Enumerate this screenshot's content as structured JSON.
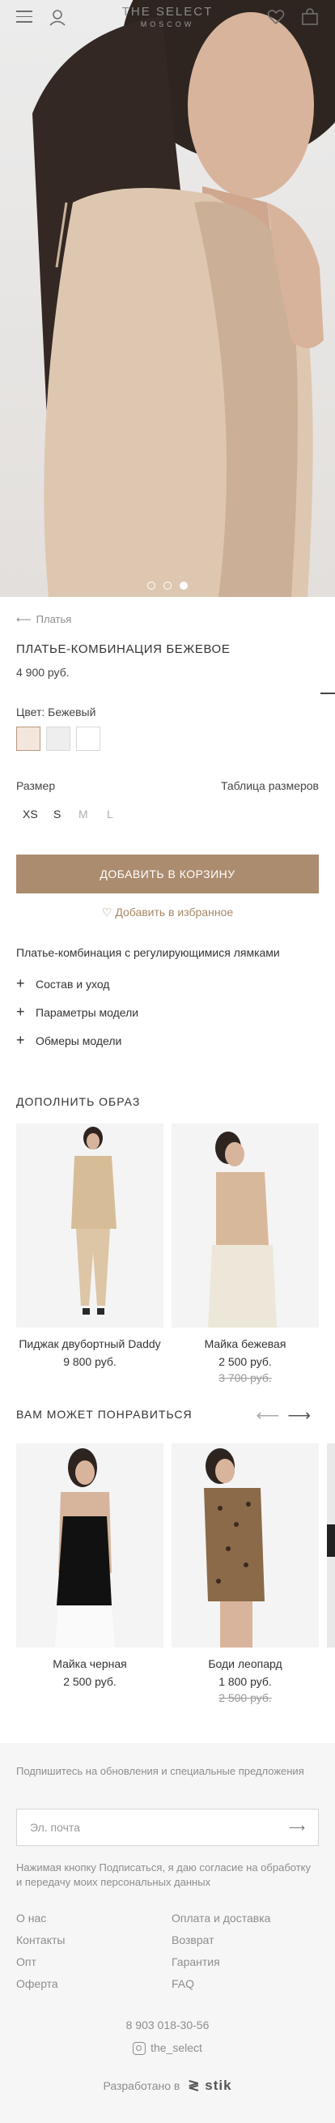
{
  "header": {
    "brand_line1": "THE SELECT",
    "brand_line2": "MOSCOW",
    "icons": [
      "menu-icon",
      "user-icon",
      "heart-icon",
      "bag-icon"
    ]
  },
  "hero": {
    "slide_count": 3,
    "active_slide": 1
  },
  "breadcrumb": {
    "back_label": "Платья"
  },
  "product": {
    "title": "ПЛАТЬЕ-КОМБИНАЦИЯ БЕЖЕВОЕ",
    "price": "4 900 руб.",
    "color_label": "Цвет: Бежевый",
    "swatches": [
      "#f3e6dc",
      "#eeeeee",
      "#ffffff"
    ],
    "size_label": "Размер",
    "size_table_label": "Таблица размеров",
    "sizes": [
      "XS",
      "S",
      "M",
      "L"
    ],
    "add_to_cart_label": "ДОБАВИТЬ В КОРЗИНУ",
    "favorite_label": "Добавить в избранное",
    "description": "Платье-комбинация с регулирующимися лямками",
    "accordion": [
      "Состав и уход",
      "Параметры модели",
      "Обмеры модели"
    ]
  },
  "complete_look": {
    "heading": "ДОПОЛНИТЬ ОБРАЗ",
    "items": [
      {
        "name": "Пиджак двубортный Daddy",
        "price": "9 800 руб.",
        "old_price": ""
      },
      {
        "name": "Майка бежевая",
        "price": "2 500 руб.",
        "old_price": "3 700 руб."
      }
    ]
  },
  "recommended": {
    "heading": "ВАМ МОЖЕТ ПОНРАВИТЬСЯ",
    "items": [
      {
        "name": "Майка черная",
        "price": "2 500 руб.",
        "old_price": ""
      },
      {
        "name": "Боди леопард",
        "price": "1 800 руб.",
        "old_price": "2 500 руб."
      }
    ]
  },
  "footer": {
    "subscribe_text": "Подпишитесь на обновления и специальные предложения",
    "email_placeholder": "Эл. почта",
    "consent_text": "Нажимая кнопку Подписаться, я даю согласие на обработку и передачу моих персональных данных",
    "links_left": [
      "О нас",
      "Контакты",
      "Опт",
      "Оферта"
    ],
    "links_right": [
      "Оплата и доставка",
      "Возврат",
      "Гарантия",
      "FAQ"
    ],
    "phone": "8 903 018-30-56",
    "instagram": "the_select",
    "developed_by_label": "Разработано в",
    "developer": "stik"
  },
  "colors": {
    "accent": "#ab8c6f",
    "text": "#333333",
    "muted": "#8d8d8d"
  }
}
